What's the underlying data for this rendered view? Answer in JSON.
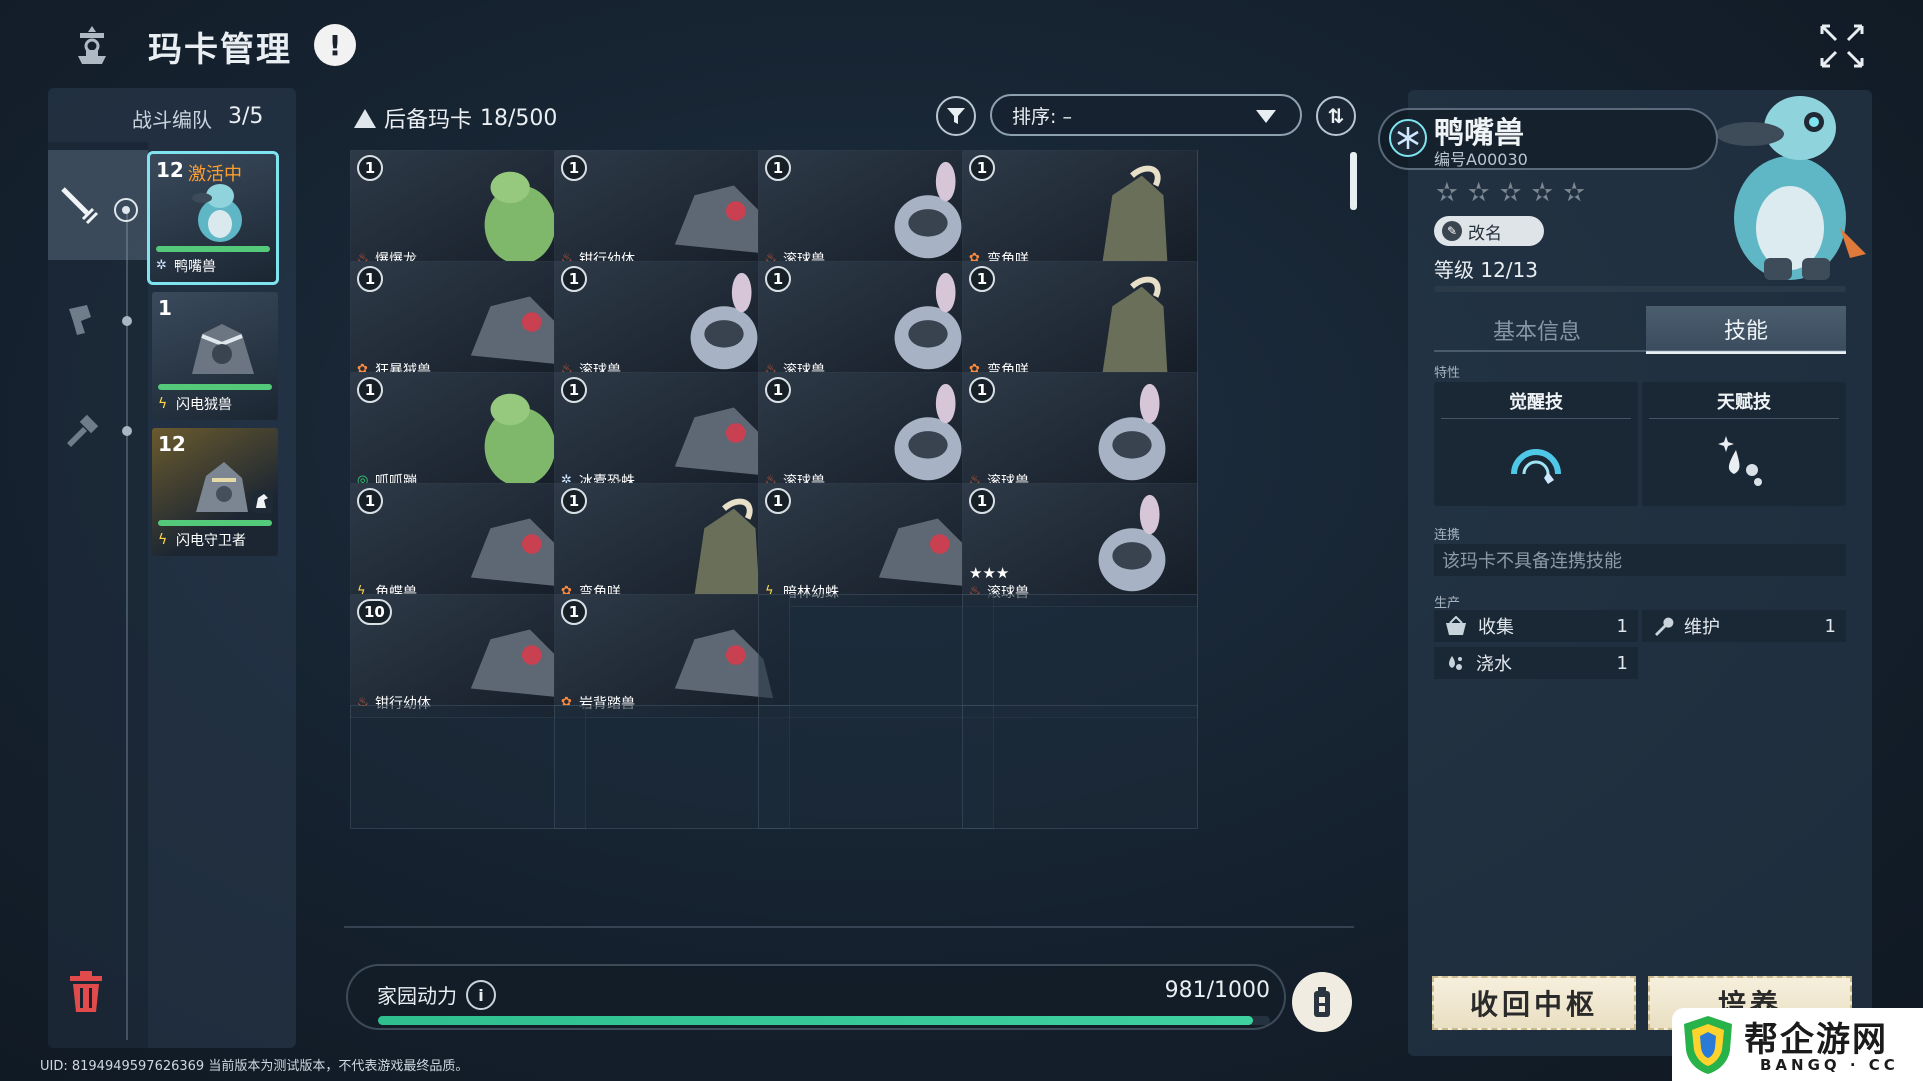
{
  "header": {
    "title": "玛卡管理",
    "alert_glyph": "!"
  },
  "team": {
    "label": "战斗编队",
    "count": "3/5",
    "cards": [
      {
        "level": "12",
        "status": "激活中",
        "name": "鸭嘴兽",
        "element": "ice",
        "active": true
      },
      {
        "level": "1",
        "status": "",
        "name": "闪电狨兽",
        "element": "electric",
        "active": false
      },
      {
        "level": "12",
        "status": "",
        "name": "闪电守卫者",
        "element": "electric",
        "active": false
      }
    ]
  },
  "reserve": {
    "title": "后备玛卡",
    "count": "18/500",
    "sort_label": "排序: –",
    "order_glyph": "⇅"
  },
  "cards": [
    {
      "level": "1",
      "name": "爆爆龙",
      "element": "fire",
      "stars": ""
    },
    {
      "level": "1",
      "name": "钳行幼体",
      "element": "fire",
      "stars": ""
    },
    {
      "level": "1",
      "name": "滚球兽",
      "element": "fire",
      "stars": ""
    },
    {
      "level": "1",
      "name": "弯角咩",
      "element": "grass",
      "stars": ""
    },
    {
      "level": "1",
      "name": "狂暴狨兽",
      "element": "grass",
      "stars": ""
    },
    {
      "level": "1",
      "name": "滚球兽",
      "element": "fire",
      "stars": ""
    },
    {
      "level": "1",
      "name": "滚球兽",
      "element": "fire",
      "stars": ""
    },
    {
      "level": "1",
      "name": "弯角咩",
      "element": "grass",
      "stars": ""
    },
    {
      "level": "1",
      "name": "呱呱蹦",
      "element": "wind",
      "stars": ""
    },
    {
      "level": "1",
      "name": "冰蠹恐蛛",
      "element": "ice",
      "stars": ""
    },
    {
      "level": "1",
      "name": "滚球兽",
      "element": "fire",
      "stars": ""
    },
    {
      "level": "1",
      "name": "滚球兽",
      "element": "fire",
      "stars": ""
    },
    {
      "level": "1",
      "name": "角蝶兽",
      "element": "electric",
      "stars": ""
    },
    {
      "level": "1",
      "name": "弯角咩",
      "element": "grass",
      "stars": ""
    },
    {
      "level": "1",
      "name": "暗林幼蛛",
      "element": "electric",
      "stars": ""
    },
    {
      "level": "1",
      "name": "滚球兽",
      "element": "fire",
      "stars": "★★★"
    },
    {
      "level": "10",
      "name": "钳行幼体",
      "element": "fire",
      "stars": ""
    },
    {
      "level": "1",
      "name": "岩背踏兽",
      "element": "grass",
      "stars": ""
    }
  ],
  "power": {
    "label": "家园动力",
    "value": "981/1000",
    "fraction": 0.981
  },
  "uid_text": "UID: 8194949597626369 当前版本为测试版本，不代表游戏最终品质。",
  "detail": {
    "name": "鸭嘴兽",
    "id": "编号A00030",
    "rename_label": "改名",
    "level_text": "等级 12/13",
    "tab_basic": "基本信息",
    "tab_skill": "技能",
    "traits_label": "特性",
    "awaken_label": "觉醒技",
    "talent_label": "天赋技",
    "link_label": "连携",
    "link_text": "该玛卡不具备连携技能",
    "production_label": "生产",
    "production": [
      {
        "name": "收集",
        "value": "1",
        "icon": "basket-icon"
      },
      {
        "name": "维护",
        "value": "1",
        "icon": "wrench-icon"
      },
      {
        "name": "浇水",
        "value": "1",
        "icon": "water-drops-icon"
      }
    ],
    "recall_label": "收回中枢",
    "cultivate_label": "培养"
  },
  "watermark": {
    "text": "帮企游网",
    "sub": "BANGQ · CC"
  },
  "colors": {
    "accent_cyan": "#7fe3f0",
    "activating": "#ff9d2e",
    "fire": "#ff6a3a",
    "grass": "#ff8a3a",
    "electric": "#ffd84a",
    "ice": "#cfe8ff",
    "wind": "#39d27a",
    "power_fill": "#2fbf8f"
  }
}
